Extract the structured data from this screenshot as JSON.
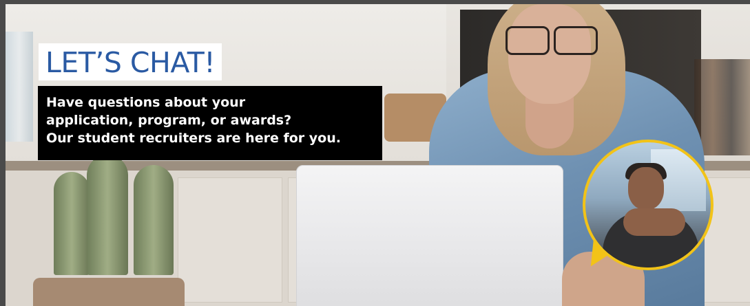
{
  "banner": {
    "headline": "LET’S CHAT!",
    "message_lines": [
      "Have questions about your",
      "application, program, or awards?",
      "Our student recruiters are here for you."
    ]
  },
  "colors": {
    "headline_text": "#2a5aa3",
    "headline_bg": "#ffffff",
    "message_bg": "#000000",
    "message_text": "#ffffff",
    "bubble_border": "#f2c318"
  },
  "images": {
    "background": "woman-using-laptop-in-kitchen",
    "bubble_photo": "smiling-student-recruiter"
  }
}
